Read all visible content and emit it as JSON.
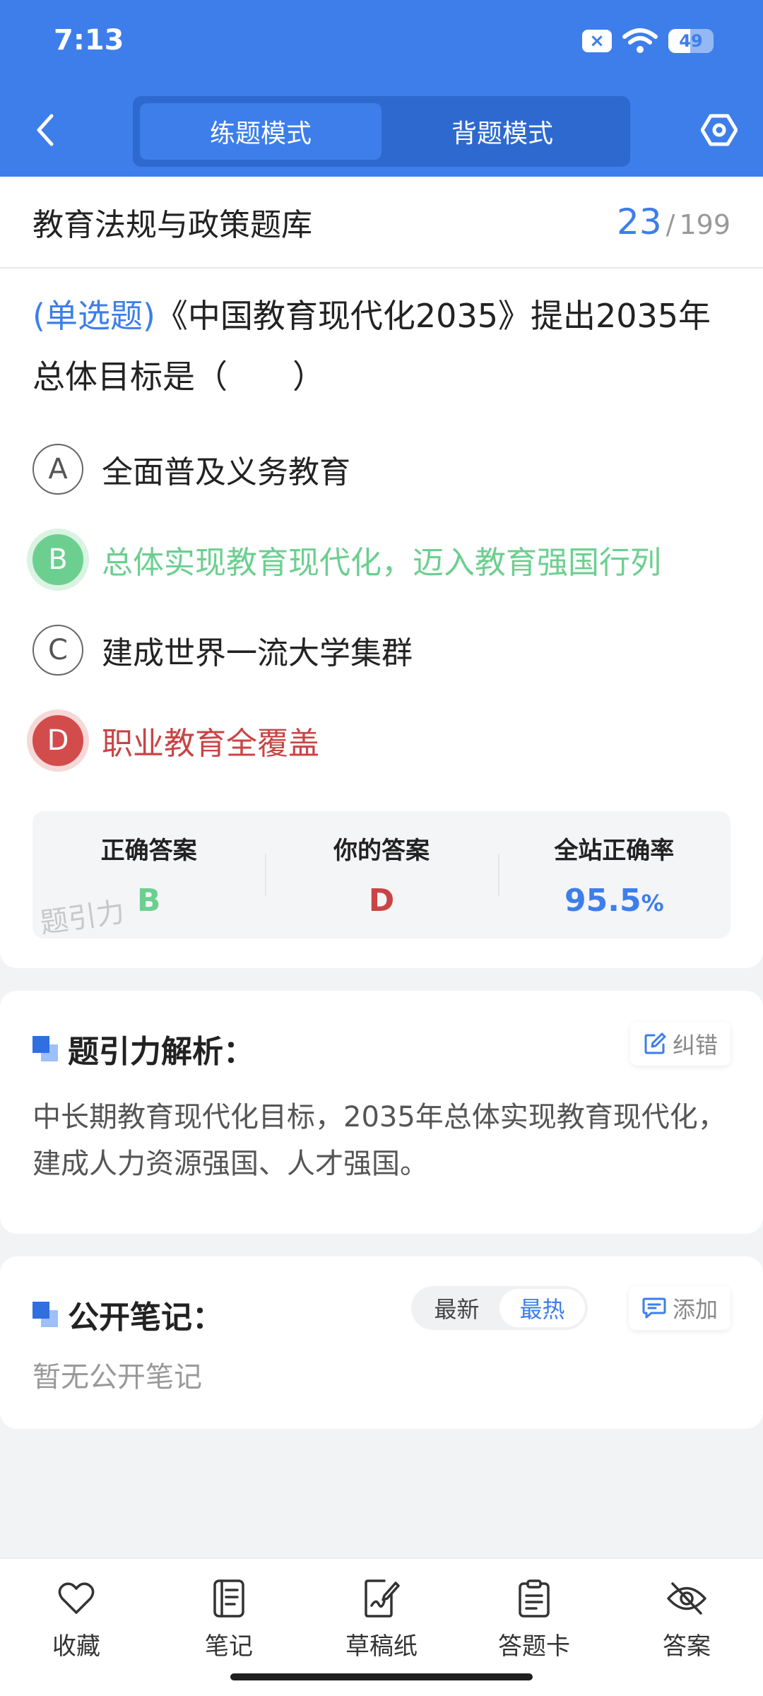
{
  "status_bar": {
    "time": "7:13",
    "sim_badge": "×",
    "battery_level": "49",
    "battery_fraction": 0.49
  },
  "header": {
    "tabs": [
      {
        "label": "练题模式",
        "active": true
      },
      {
        "label": "背题模式",
        "active": false
      }
    ]
  },
  "question_bank": {
    "title": "教育法规与政策题库",
    "current": "23",
    "separator": "/",
    "total": "199"
  },
  "question": {
    "type": "(单选题)",
    "text": "《中国教育现代化2035》提出2035年总体目标是（　　）"
  },
  "options": [
    {
      "letter": "A",
      "text": "全面普及义务教育",
      "state": "normal"
    },
    {
      "letter": "B",
      "text": "总体实现教育现代化，迈入教育强国行列",
      "state": "correct"
    },
    {
      "letter": "C",
      "text": "建成世界一流大学集群",
      "state": "normal"
    },
    {
      "letter": "D",
      "text": "职业教育全覆盖",
      "state": "wrong"
    }
  ],
  "stats": {
    "correct_label": "正确答案",
    "correct_value": "B",
    "yours_label": "你的答案",
    "yours_value": "D",
    "rate_label": "全站正确率",
    "rate_value": "95.5",
    "rate_unit": "%",
    "watermark": "题引力"
  },
  "analysis": {
    "title": "题引力解析：",
    "report_label": "纠错",
    "text": "中长期教育现代化目标，2035年总体实现教育现代化，建成人力资源强国、人才强国。"
  },
  "notes": {
    "title": "公开笔记：",
    "sort_options": [
      "最新",
      "最热"
    ],
    "sort_active": "最热",
    "add_label": "添加",
    "empty_text": "暂无公开笔记"
  },
  "bottom_tabs": [
    {
      "label": "收藏",
      "icon": "heart-icon"
    },
    {
      "label": "笔记",
      "icon": "notebook-icon"
    },
    {
      "label": "草稿纸",
      "icon": "draft-icon"
    },
    {
      "label": "答题卡",
      "icon": "clipboard-icon"
    },
    {
      "label": "答案",
      "icon": "eye-off-icon"
    }
  ],
  "colors": {
    "primary": "#3d7eea",
    "correct": "#6ccf90",
    "wrong": "#c94444"
  }
}
